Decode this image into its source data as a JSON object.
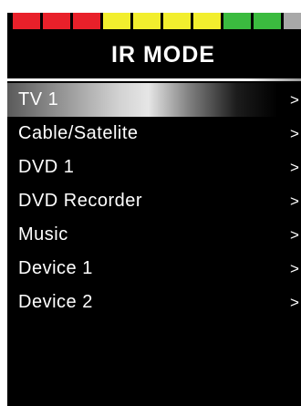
{
  "signal_bar": {
    "segments": [
      {
        "color": "#e8202a"
      },
      {
        "color": "#e8202a"
      },
      {
        "color": "#e8202a"
      },
      {
        "color": "#f2ee2e"
      },
      {
        "color": "#f2ee2e"
      },
      {
        "color": "#f2ee2e"
      },
      {
        "color": "#f2ee2e"
      },
      {
        "color": "#3bbb3f"
      },
      {
        "color": "#3bbb3f"
      },
      {
        "color": "#a8a8a8"
      }
    ]
  },
  "header": {
    "title": "IR MODE"
  },
  "menu": {
    "chevron_icon": "chevron-right-icon",
    "selected_index": 0,
    "items": [
      {
        "label": "TV 1",
        "chevron": ">"
      },
      {
        "label": "Cable/Satelite",
        "chevron": ">"
      },
      {
        "label": "DVD 1",
        "chevron": ">"
      },
      {
        "label": "DVD Recorder",
        "chevron": ">"
      },
      {
        "label": "Music",
        "chevron": ">"
      },
      {
        "label": "Device 1",
        "chevron": ">"
      },
      {
        "label": "Device 2",
        "chevron": ">"
      }
    ]
  },
  "colors": {
    "background": "#000000",
    "text": "#ffffff",
    "highlight": "#d2d2d2"
  }
}
